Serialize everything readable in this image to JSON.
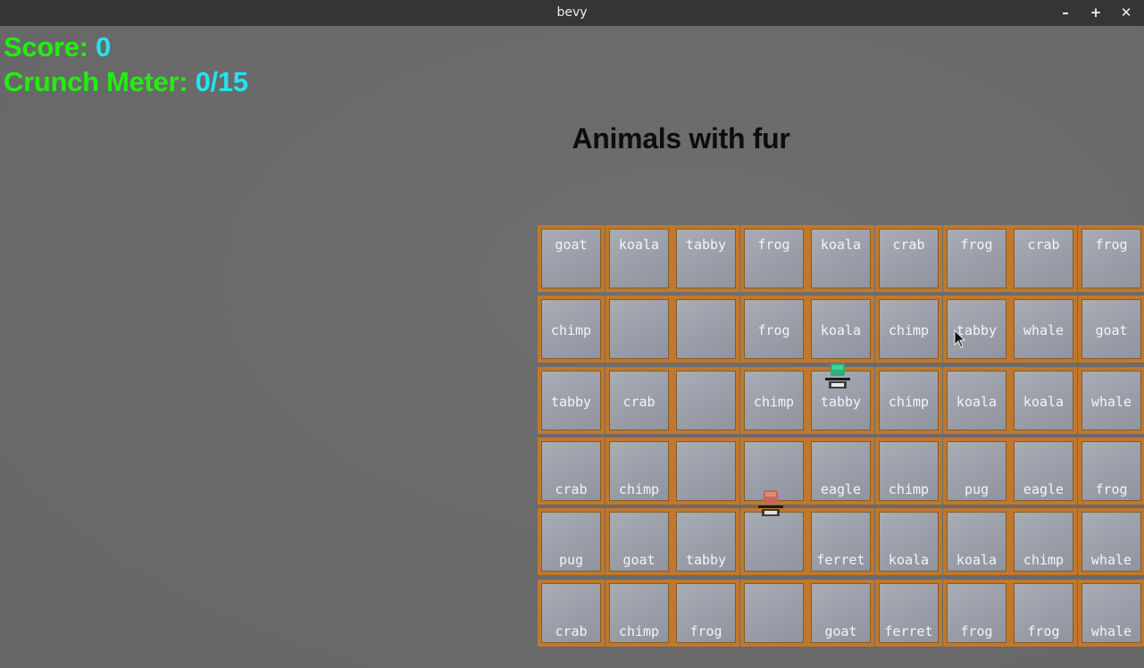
{
  "window": {
    "title": "bevy",
    "minimize_glyph": "–",
    "maximize_glyph": "+",
    "close_glyph": "✕"
  },
  "hud": {
    "score_label": "Score:",
    "score_value": "0",
    "crunch_label": "Crunch Meter:",
    "crunch_value": "0/15"
  },
  "prompt": "Animals with fur",
  "board": {
    "rows": [
      [
        "goat",
        "koala",
        "tabby",
        "frog",
        "koala",
        "crab",
        "frog",
        "crab",
        "frog"
      ],
      [
        "chimp",
        "",
        "",
        "frog",
        "koala",
        "chimp",
        "tabby",
        "whale",
        "goat"
      ],
      [
        "tabby",
        "crab",
        "",
        "chimp",
        "tabby",
        "chimp",
        "koala",
        "koala",
        "whale"
      ],
      [
        "crab",
        "chimp",
        "",
        "",
        "eagle",
        "chimp",
        "pug",
        "eagle",
        "frog"
      ],
      [
        "pug",
        "goat",
        "tabby",
        "",
        "ferret",
        "koala",
        "koala",
        "chimp",
        "whale"
      ],
      [
        "crab",
        "chimp",
        "frog",
        "",
        "goat",
        "ferret",
        "frog",
        "frog",
        "whale"
      ]
    ]
  },
  "colors": {
    "tile_border": "#c0782c",
    "score_label": "#22ee11",
    "score_value": "#22e4f0",
    "player": "#2ab07a",
    "enemy": "#c8665a"
  },
  "icons": {
    "player": "player-muncher-sprite",
    "enemy": "troggle-sprite",
    "cursor": "mouse-pointer-icon"
  }
}
